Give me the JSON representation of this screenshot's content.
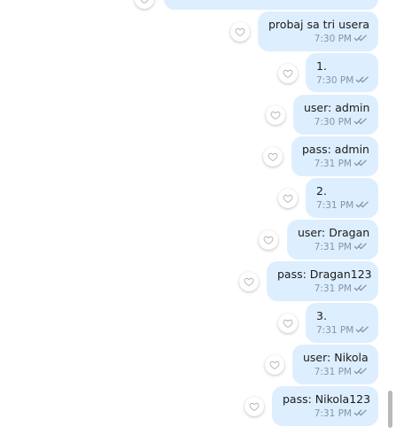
{
  "window": {
    "title": ""
  },
  "chat": {
    "messages": [
      {
        "text": "",
        "time": "",
        "status": "read"
      },
      {
        "text": "probaj sa tri usera",
        "time": "7:30 PM",
        "status": "read"
      },
      {
        "text": "1.",
        "time": "7:30 PM",
        "status": "read"
      },
      {
        "text": "user: admin",
        "time": "7:30 PM",
        "status": "read"
      },
      {
        "text": "pass: admin",
        "time": "7:31 PM",
        "status": "read"
      },
      {
        "text": "2.",
        "time": "7:31 PM",
        "status": "read"
      },
      {
        "text": "user: Dragan",
        "time": "7:31 PM",
        "status": "read"
      },
      {
        "text": "pass: Dragan123",
        "time": "7:31 PM",
        "status": "read"
      },
      {
        "text": "3.",
        "time": "7:31 PM",
        "status": "read"
      },
      {
        "text": "user: Nikola",
        "time": "7:31 PM",
        "status": "read"
      },
      {
        "text": "pass: Nikola123",
        "time": "7:31 PM",
        "status": "read"
      }
    ]
  },
  "icons": {
    "reaction": "heart-icon",
    "status": "double-check-icon"
  },
  "colors": {
    "bubble_background": "#ddeeff",
    "meta_text": "#8096ac",
    "message_text": "#1b1b1b",
    "page_background": "#ffffff"
  }
}
